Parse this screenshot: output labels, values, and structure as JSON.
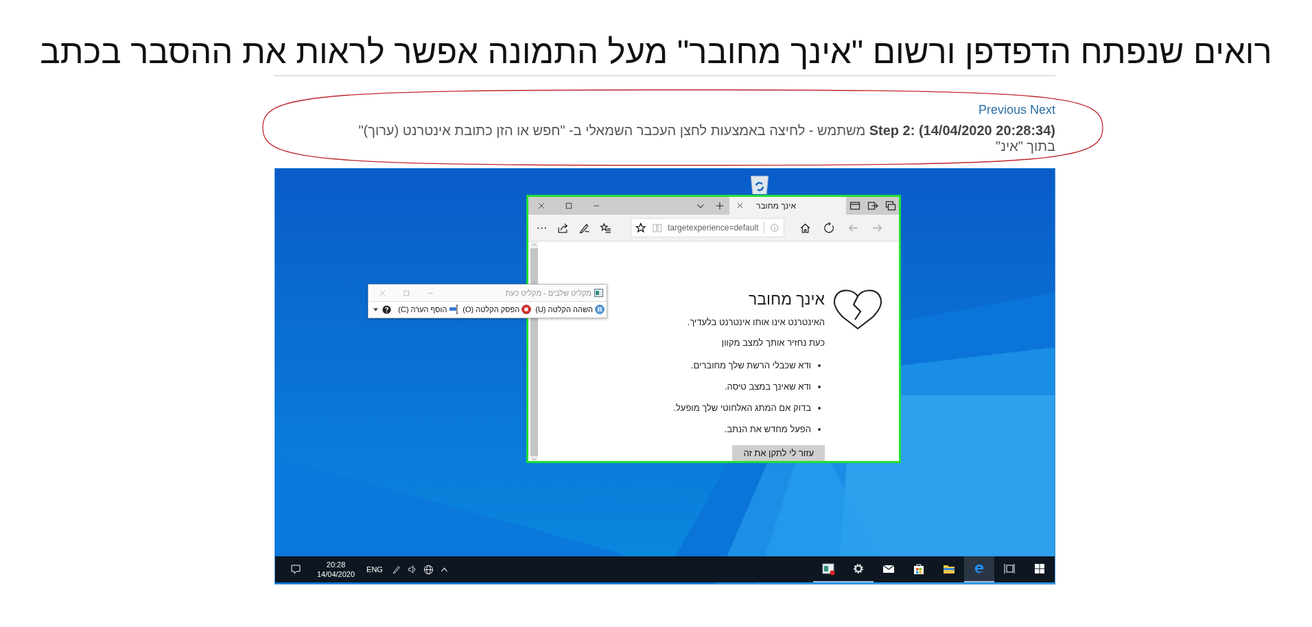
{
  "page": {
    "title": "רואים שנפתח הדפדפן ורשום \"אינך מחובר\" מעל התמונה אפשר לראות את ההסבר בכתב"
  },
  "nav": {
    "links": [
      "Next",
      "Previous"
    ]
  },
  "step": {
    "text": "**Step 2: (14/04/2020 20:28:34)** משתמש - לחיצה באמצעות לחצן העכבר השמאלי ב- \"חפש או הזן כתובת אינטרנט (ערוך)\" בתוך \"אינ\"",
    "circled": true
  },
  "screenshot": {
    "browser": {
      "highlighted": true,
      "tabs": [
        {
          "label": "אינך מחובר",
          "selected": true
        }
      ],
      "address": "targetexperience=default",
      "heading": "אינך מחובר",
      "lines": [
        "האינטרנט אינו אותו אינטרנט בלעדיך.",
        "כעת נחזיר אותך למצב מקוון"
      ],
      "bullets": [
        "ודא שכבלי הרשת שלך מחוברים.",
        "ודא שאינך במצב טיסה.",
        "בדוק אם המתג האלחוטי שלך מופעל.",
        "הפעל מחדש את הנתב."
      ],
      "button": "עזור לי לתקן את זה"
    },
    "recorder": {
      "title": "מקליט שלבים - מקליט כעת",
      "buttons": [
        {
          "kind": "pause",
          "label": "השהה הקלטה (U)"
        },
        {
          "kind": "stop",
          "label": "הפסק הקלטה (O)"
        },
        {
          "kind": "comment",
          "label": "הוסף הערה (C)"
        }
      ]
    },
    "taskbar": {
      "time": "20:28",
      "date": "14/04/2020",
      "language": "ENG",
      "apps": [
        {
          "kind": "recorder",
          "running": true,
          "active": false
        },
        {
          "kind": "settings",
          "running": true,
          "active": false
        },
        {
          "kind": "mail",
          "running": false,
          "active": false
        },
        {
          "kind": "store",
          "running": false,
          "active": false
        },
        {
          "kind": "explorer",
          "running": false,
          "active": false
        },
        {
          "kind": "edge",
          "running": true,
          "active": true
        },
        {
          "kind": "taskview",
          "running": false,
          "active": false
        },
        {
          "kind": "start",
          "running": false,
          "active": false
        }
      ]
    }
  }
}
